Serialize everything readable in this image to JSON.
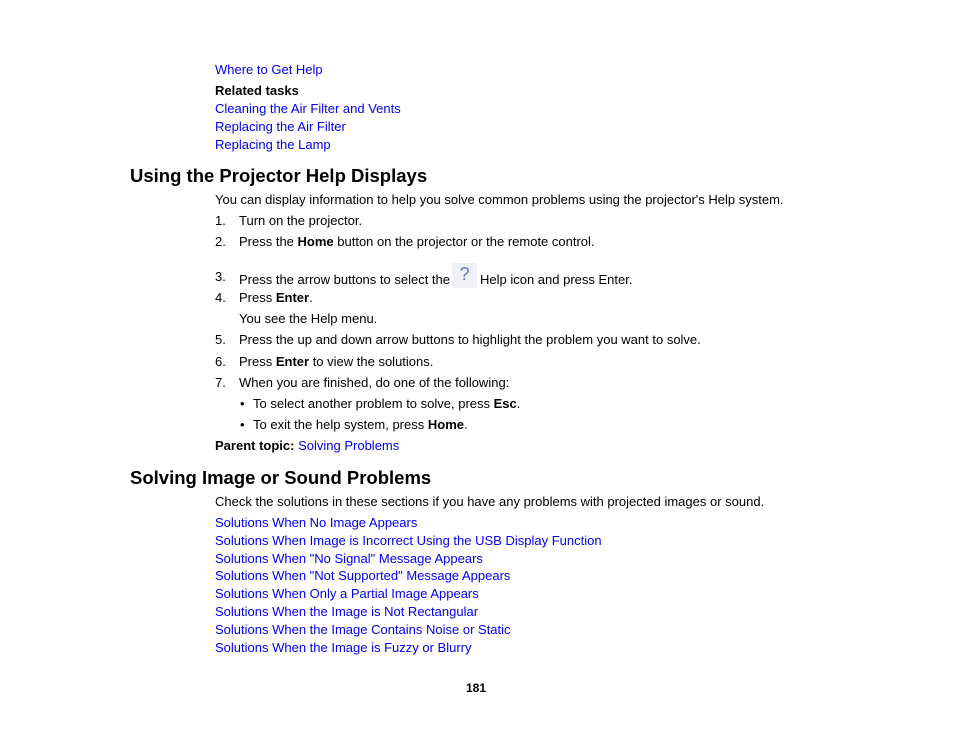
{
  "top_links": {
    "where_help": "Where to Get Help",
    "related_tasks_label": "Related tasks",
    "tasks": [
      "Cleaning the Air Filter and Vents",
      "Replacing the Air Filter",
      "Replacing the Lamp"
    ]
  },
  "section1": {
    "title": "Using the Projector Help Displays",
    "intro": "You can display information to help you solve common problems using the projector's Help system.",
    "steps": {
      "s1": {
        "num": "1.",
        "text": "Turn on the projector."
      },
      "s2": {
        "num": "2.",
        "pre": "Press the ",
        "bold": "Home",
        "post": " button on the projector or the remote control."
      },
      "s3": {
        "num": "3.",
        "pre": "Press the arrow buttons to select the",
        "icon": "?",
        "post": "Help icon and press Enter."
      },
      "s4": {
        "num": "4.",
        "pre": "Press ",
        "bold": "Enter",
        "post": ".",
        "note": "You see the Help menu."
      },
      "s5": {
        "num": "5.",
        "text": "Press the up and down arrow buttons to highlight the problem you want to solve."
      },
      "s6": {
        "num": "6.",
        "pre": "Press ",
        "bold": "Enter",
        "post": " to view the solutions."
      },
      "s7": {
        "num": "7.",
        "text": "When you are finished, do one of the following:"
      }
    },
    "bullets": {
      "b1": {
        "mark": "•",
        "pre": "To select another problem to solve, press ",
        "bold": "Esc",
        "post": "."
      },
      "b2": {
        "mark": "•",
        "pre": "To exit the help system, press ",
        "bold": "Home",
        "post": "."
      }
    },
    "parent_label": "Parent topic:",
    "parent_link": "Solving Problems"
  },
  "section2": {
    "title": "Solving Image or Sound Problems",
    "intro": "Check the solutions in these sections if you have any problems with projected images or sound.",
    "links": [
      "Solutions When No Image Appears",
      "Solutions When Image is Incorrect Using the USB Display Function",
      "Solutions When \"No Signal\" Message Appears",
      "Solutions When \"Not Supported\" Message Appears",
      "Solutions When Only a Partial Image Appears",
      "Solutions When the Image is Not Rectangular",
      "Solutions When the Image Contains Noise or Static",
      "Solutions When the Image is Fuzzy or Blurry"
    ]
  },
  "page_number": "181",
  "colors": {
    "link": "#0000ee",
    "text": "#000000"
  }
}
